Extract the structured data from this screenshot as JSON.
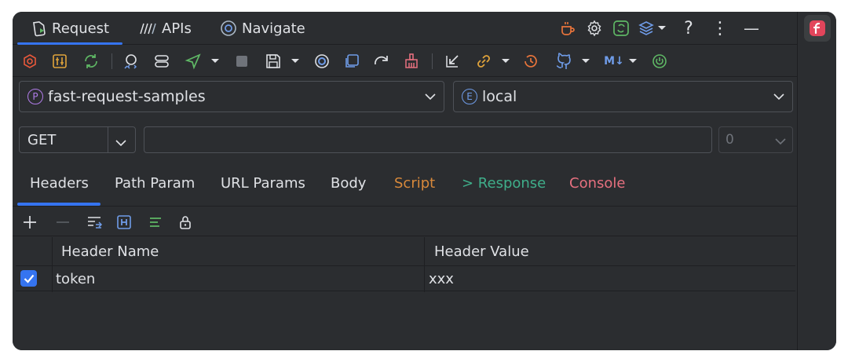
{
  "top_tabs": [
    {
      "label": "Request",
      "icon": "request-icon"
    },
    {
      "label": "APIs",
      "icon": "apis-icon"
    },
    {
      "label": "Navigate",
      "icon": "navigate-icon"
    }
  ],
  "top_right": {
    "help_label": "?",
    "more_label": "⋮",
    "minimize_label": "—"
  },
  "project": {
    "badge": "P",
    "name": "fast-request-samples"
  },
  "environment": {
    "badge": "E",
    "name": "local"
  },
  "request": {
    "method": "GET",
    "url": "",
    "url_placeholder": "",
    "count": "0"
  },
  "section_tabs": [
    {
      "label": "Headers",
      "color": "#dfe1e5"
    },
    {
      "label": "Path Param",
      "color": "#dfe1e5"
    },
    {
      "label": "URL Params",
      "color": "#dfe1e5"
    },
    {
      "label": "Body",
      "color": "#dfe1e5"
    },
    {
      "label": "Script",
      "color": "#d8893b"
    },
    {
      "label": "> Response",
      "color": "#3fae8a"
    },
    {
      "label": "Console",
      "color": "#e6707f"
    }
  ],
  "headers_table": {
    "columns": [
      "Header Name",
      "Header Value"
    ],
    "rows": [
      {
        "enabled": true,
        "name": "token",
        "value": "xxx"
      }
    ]
  },
  "toolbar": {
    "markdown_label": "M↓"
  },
  "colors": {
    "accent": "#3574f0",
    "background": "#2b2d30",
    "border": "#4e5157"
  }
}
